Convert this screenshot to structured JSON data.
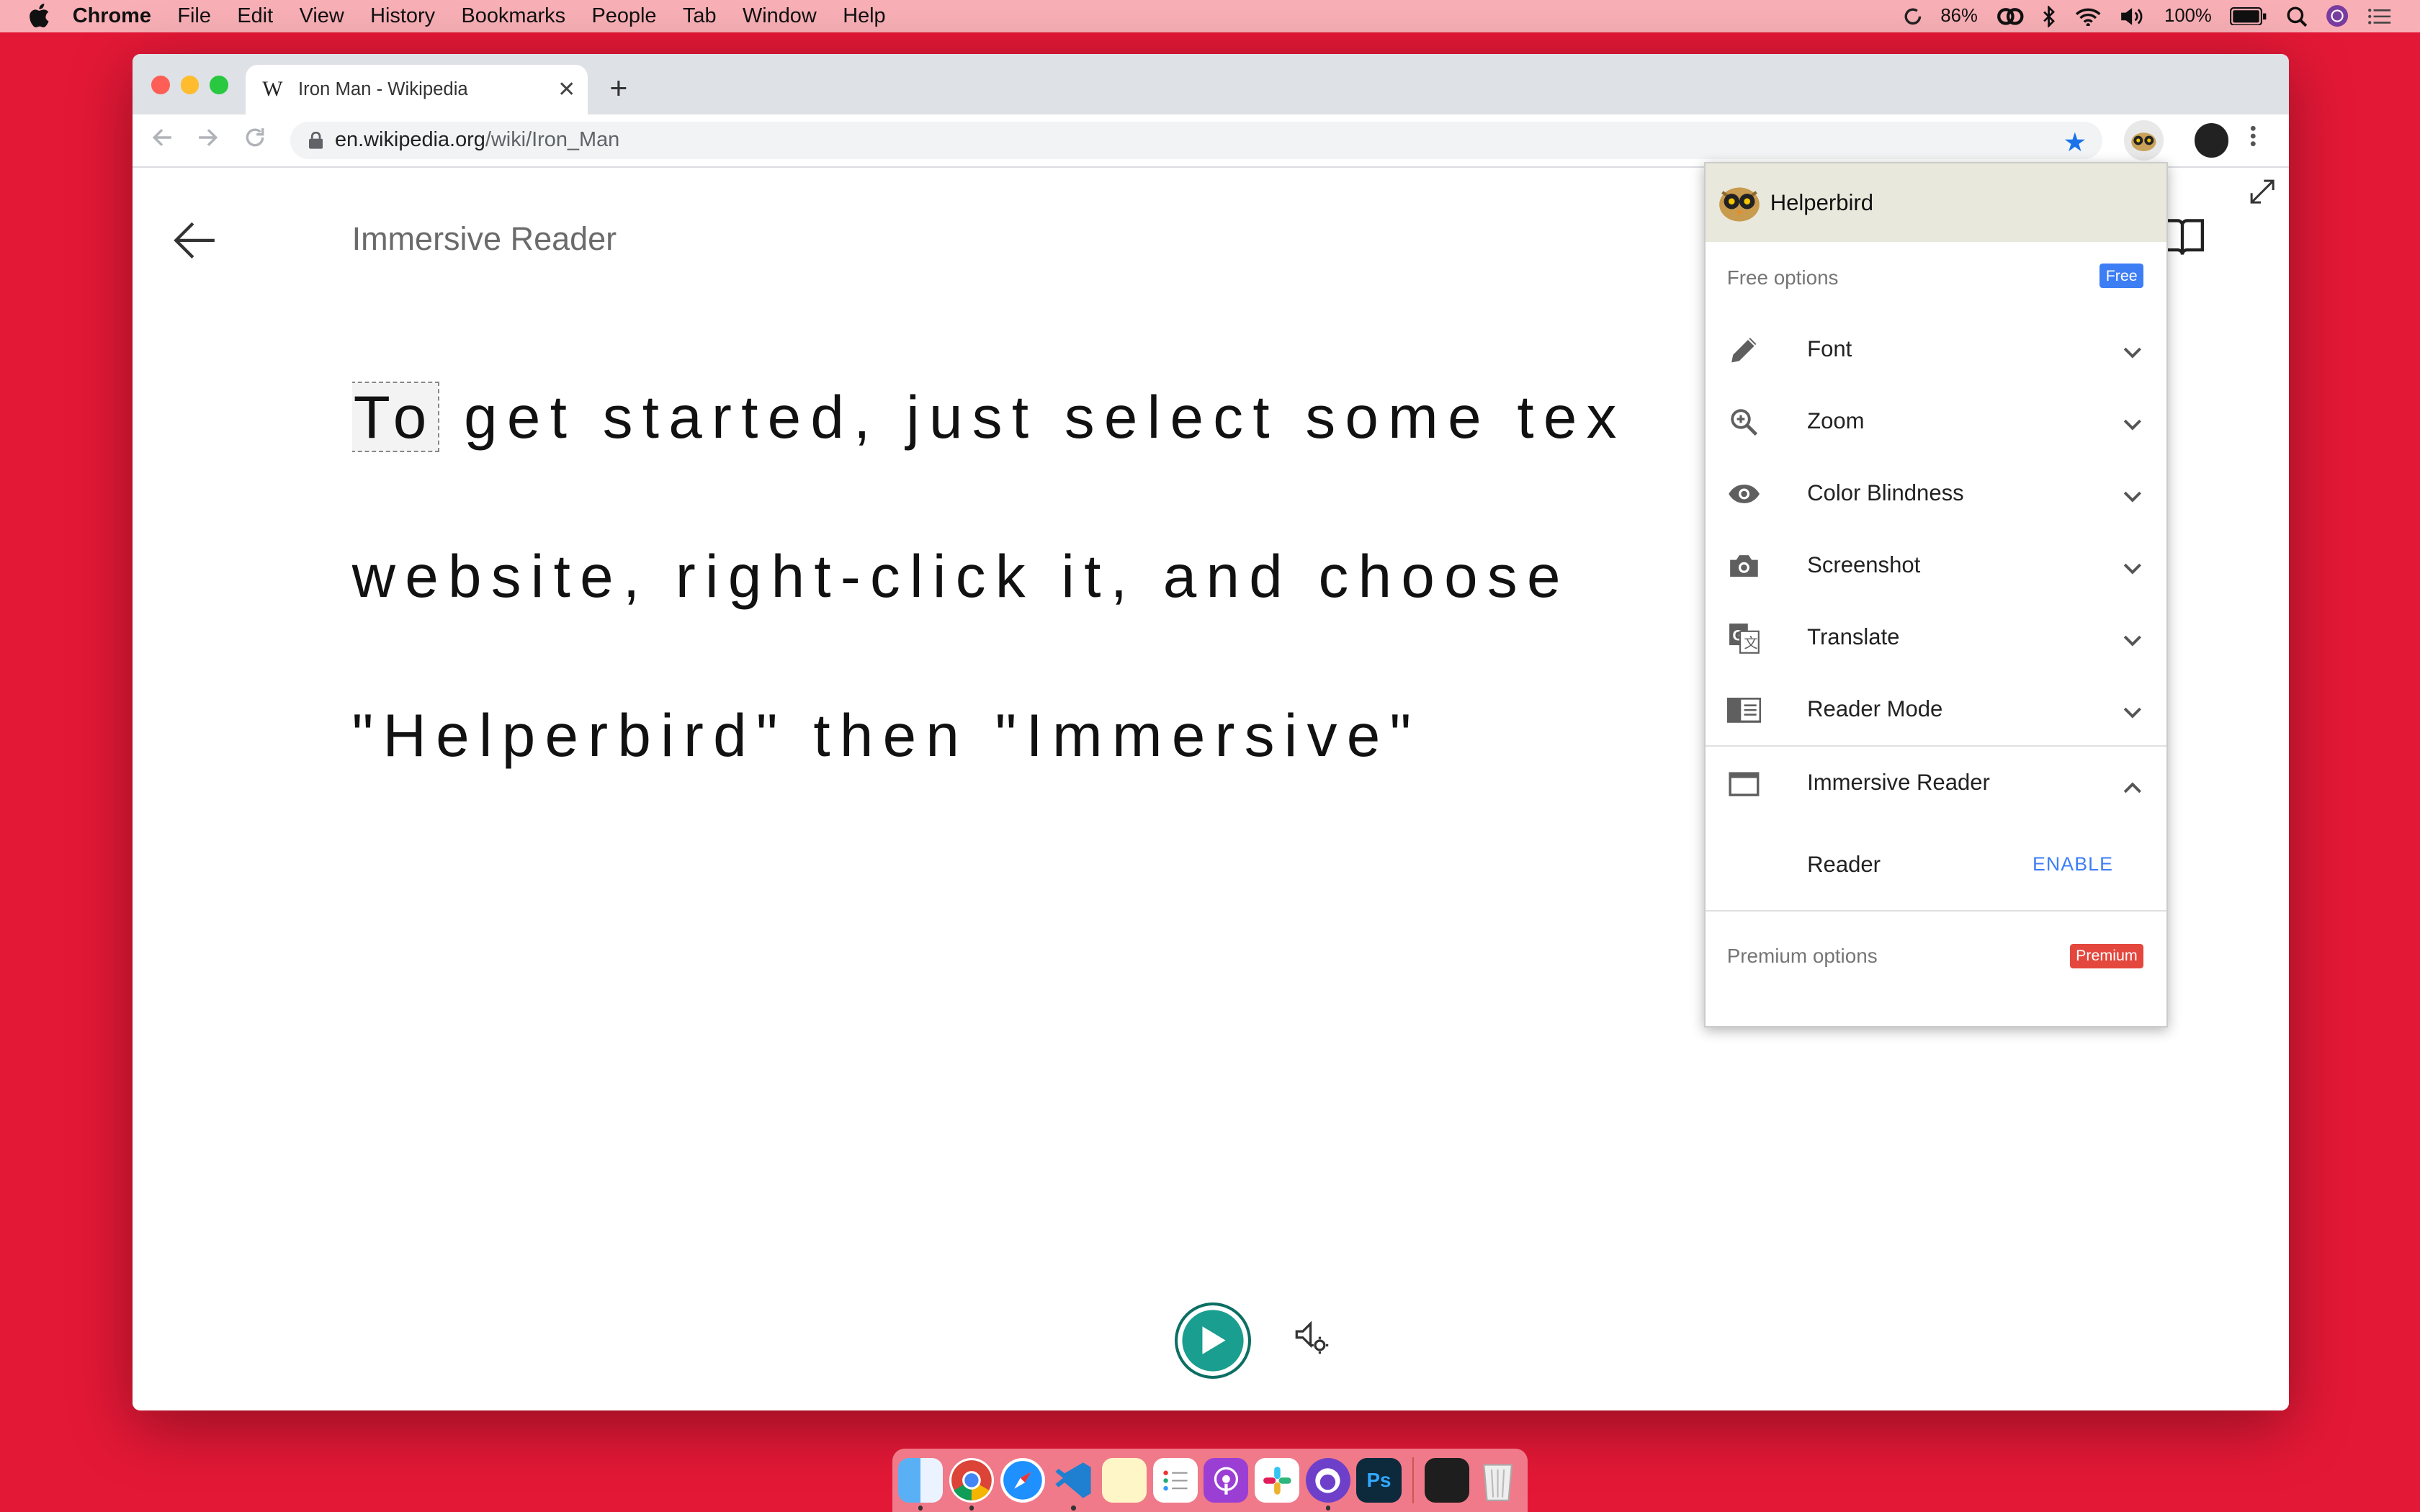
{
  "menubar": {
    "app_name": "Chrome",
    "items": [
      "File",
      "Edit",
      "View",
      "History",
      "Bookmarks",
      "People",
      "Tab",
      "Window",
      "Help"
    ],
    "cpu": "86%",
    "battery": "100%"
  },
  "browser": {
    "tab_title": "Iron Man - Wikipedia",
    "tab_favicon": "W",
    "new_tab": "+",
    "url_host": "en.wikipedia.org",
    "url_path": "/wiki/Iron_Man"
  },
  "reader": {
    "title": "Immersive Reader",
    "first_word": "To",
    "line1_rest": " get started, just select some tex",
    "line2": "website, right-click it, and choose",
    "line3": "\"Helperbird\" then \"Immersive\""
  },
  "panel": {
    "title": "Helperbird",
    "free_label": "Free options",
    "free_badge": "Free",
    "options": [
      {
        "label": "Font",
        "icon": "pencil-icon"
      },
      {
        "label": "Zoom",
        "icon": "zoom-icon"
      },
      {
        "label": "Color Blindness",
        "icon": "eye-icon"
      },
      {
        "label": "Screenshot",
        "icon": "camera-icon"
      },
      {
        "label": "Translate",
        "icon": "translate-icon"
      },
      {
        "label": "Reader Mode",
        "icon": "reader-mode-icon"
      },
      {
        "label": "Immersive Reader",
        "icon": "window-icon"
      }
    ],
    "sub_option": {
      "label": "Reader",
      "action": "ENABLE"
    },
    "premium_label": "Premium options",
    "premium_badge": "Premium"
  },
  "dock": {
    "apps": [
      "Finder",
      "Chrome",
      "Safari",
      "VS Code",
      "Notes",
      "Reminders",
      "Podcasts",
      "Slack",
      "GitHub Desktop",
      "Photoshop",
      "Terminal",
      "Trash"
    ],
    "photoshop_label": "Ps"
  },
  "colors": {
    "desktop": "#e31836",
    "accent_blue": "#3d7ef5",
    "premium_red": "#e4473d",
    "play_teal": "#1a9e8f"
  }
}
